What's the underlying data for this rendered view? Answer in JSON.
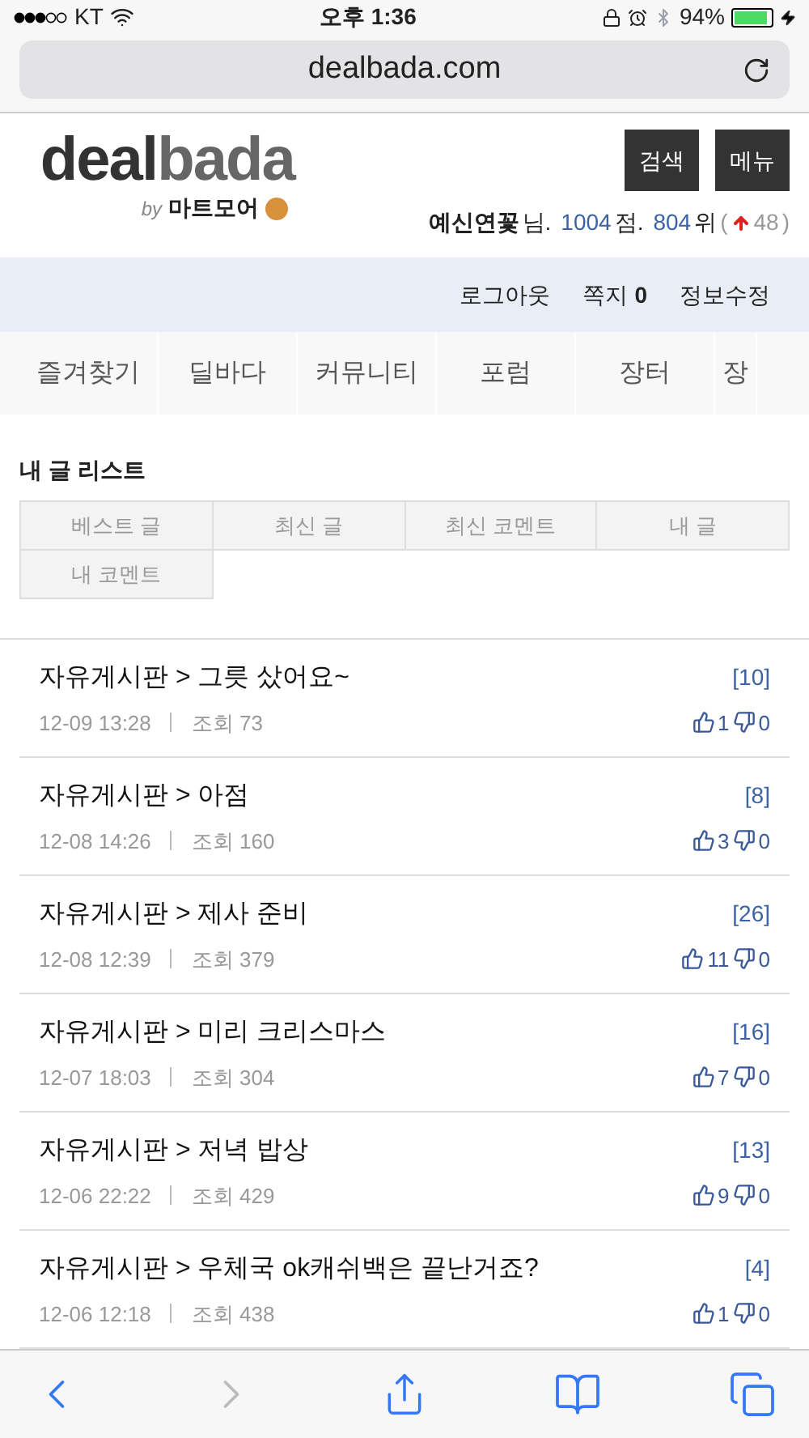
{
  "status_bar": {
    "carrier": "KT",
    "time": "오후 1:36",
    "battery": "94%"
  },
  "address_bar": {
    "url": "dealbada.com"
  },
  "header": {
    "logo_dark": "deal",
    "logo_light": "bada",
    "logo_by": "by",
    "logo_brand": "마트모어",
    "buttons": [
      "검색",
      "메뉴"
    ],
    "user": {
      "name": "예신연꽃",
      "suffix": "님.",
      "points": "1004",
      "points_unit": "점.",
      "rank": "804",
      "rank_unit": "위",
      "open": "(",
      "change": "48",
      "close": ")"
    }
  },
  "user_nav": [
    {
      "label": "로그아웃"
    },
    {
      "label": "쪽지",
      "count": "0"
    },
    {
      "label": "정보수정"
    }
  ],
  "categories": [
    {
      "label": "즐겨찾기",
      "selected": false
    },
    {
      "label": "딜바다",
      "selected": false
    },
    {
      "label": "커뮤니티",
      "selected": false
    },
    {
      "label": "포럼",
      "selected": false
    },
    {
      "label": "장터",
      "selected": false
    },
    {
      "label": "장",
      "selected": false
    }
  ],
  "section_title": "내 글 리스트",
  "list_tabs": [
    {
      "label": "베스트 글",
      "selected": false
    },
    {
      "label": "최신 글",
      "selected": false
    },
    {
      "label": "최신 코멘트",
      "selected": false
    },
    {
      "label": "내 글",
      "selected": false
    },
    {
      "label": "내 코멘트",
      "selected": false
    }
  ],
  "posts": [
    {
      "title": "자유게시판 > 그릇 샀어요~",
      "comments": "[10]",
      "date": "12-09 13:28",
      "views": "조회 73",
      "up": "1",
      "down": "0"
    },
    {
      "title": "자유게시판 > 아점",
      "comments": "[8]",
      "date": "12-08 14:26",
      "views": "조회 160",
      "up": "3",
      "down": "0"
    },
    {
      "title": "자유게시판 > 제사 준비",
      "comments": "[26]",
      "date": "12-08 12:39",
      "views": "조회 379",
      "up": "11",
      "down": "0"
    },
    {
      "title": "자유게시판 > 미리 크리스마스",
      "comments": "[16]",
      "date": "12-07 18:03",
      "views": "조회 304",
      "up": "7",
      "down": "0"
    },
    {
      "title": "자유게시판 > 저녁 밥상",
      "comments": "[13]",
      "date": "12-06 22:22",
      "views": "조회 429",
      "up": "9",
      "down": "0"
    },
    {
      "title": "자유게시판 > 우체국 ok캐쉬백은 끝난거죠?",
      "comments": "[4]",
      "date": "12-06 12:18",
      "views": "조회 438",
      "up": "1",
      "down": "0"
    }
  ],
  "toolbar": {
    "back": {
      "disabled": false
    },
    "forward": {
      "disabled": true
    }
  }
}
